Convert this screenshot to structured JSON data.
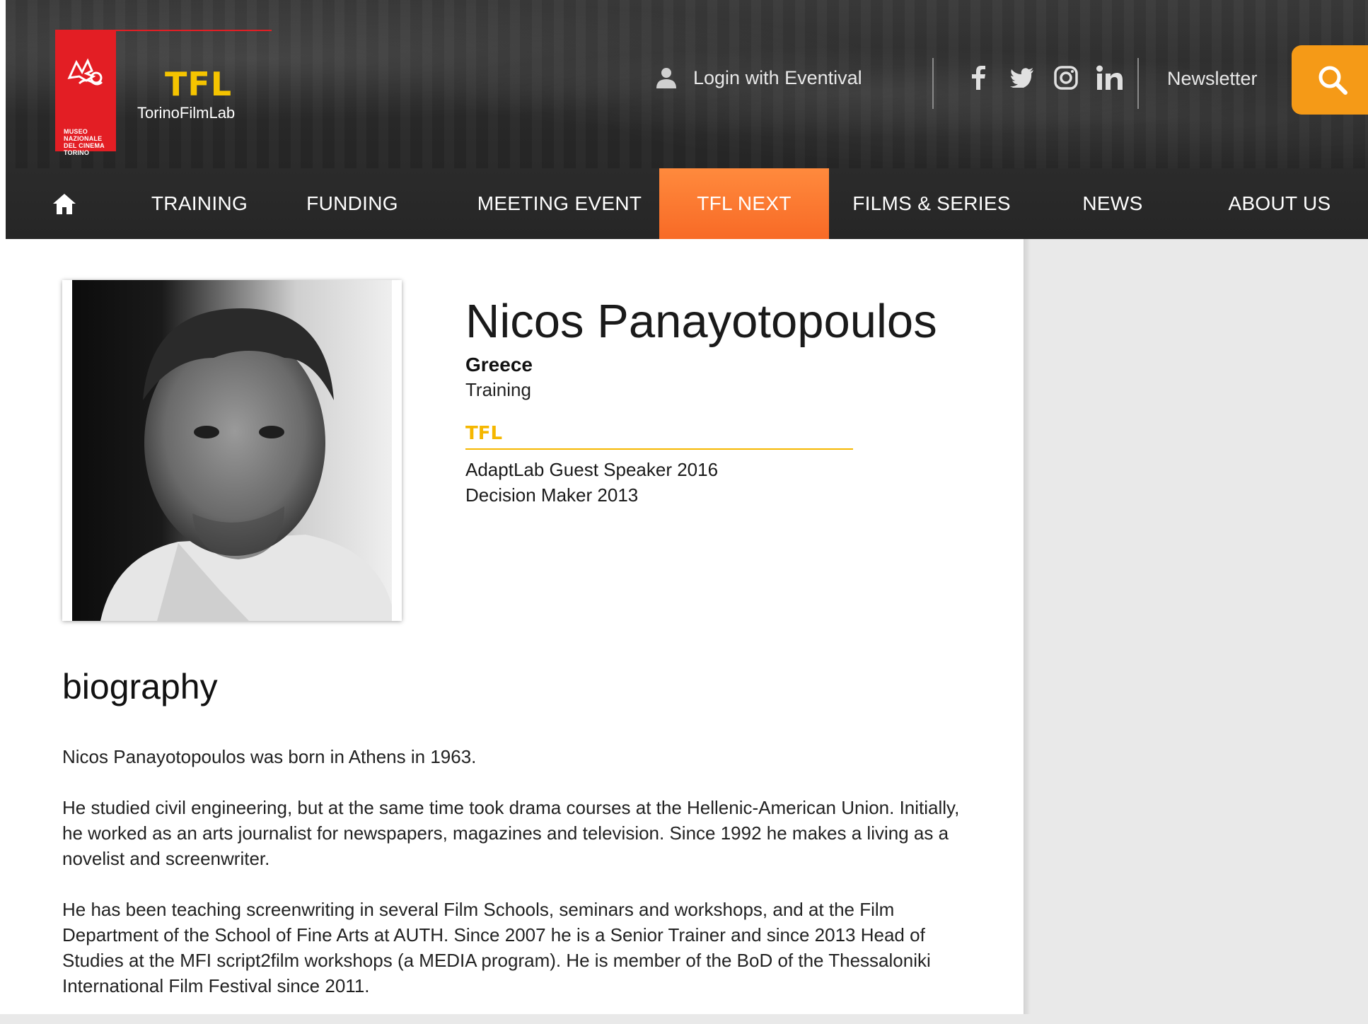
{
  "header": {
    "museum_logo_text": "MUSEO\nNAZIONALE\nDEL CINEMA\nTORINO",
    "tfl_logo_title": "TFL",
    "tfl_logo_subtitle": "TorinoFilmLab",
    "login_label": "Login with Eventival",
    "social_icons": [
      "facebook-icon",
      "twitter-icon",
      "instagram-icon",
      "linkedin-icon"
    ],
    "newsletter_label": "Newsletter",
    "search_icon": "search-icon",
    "accent_color": "#f59a17"
  },
  "nav": {
    "home_icon": "home-icon",
    "items": [
      {
        "label": "TRAINING"
      },
      {
        "label": "FUNDING"
      },
      {
        "label": "MEETING EVENT"
      },
      {
        "label": "TFL NEXT",
        "active": true
      },
      {
        "label": "FILMS & SERIES"
      },
      {
        "label": "NEWS"
      },
      {
        "label": "ABOUT US"
      }
    ],
    "active_color": "#f86a26"
  },
  "profile": {
    "name": "Nicos Panayotopoulos",
    "country": "Greece",
    "category": "Training",
    "tfl_label": "TFL",
    "tfl_color": "#f5b700",
    "roles": [
      "AdaptLab Guest Speaker 2016",
      "Decision Maker 2013"
    ]
  },
  "biography": {
    "heading": "biography",
    "paragraphs": [
      "Nicos Panayotopoulos was born in Athens in 1963.",
      "He studied civil engineering, but at the same time took drama courses at the Hellenic-American Union. Initially, he worked as an arts journalist for newspapers, magazines and television. Since 1992 he makes a living as a novelist and screenwriter.",
      "He has been teaching screenwriting in several Film Schools, seminars and workshops, and at the Film Department of the School of Fine Arts at AUTH. Since 2007 he is a Senior Trainer and since 2013 Head of Studies at the MFI script2film workshops (a MEDIA program). He is member of the BoD of the Thessaloniki International Film Festival since 2011."
    ]
  }
}
